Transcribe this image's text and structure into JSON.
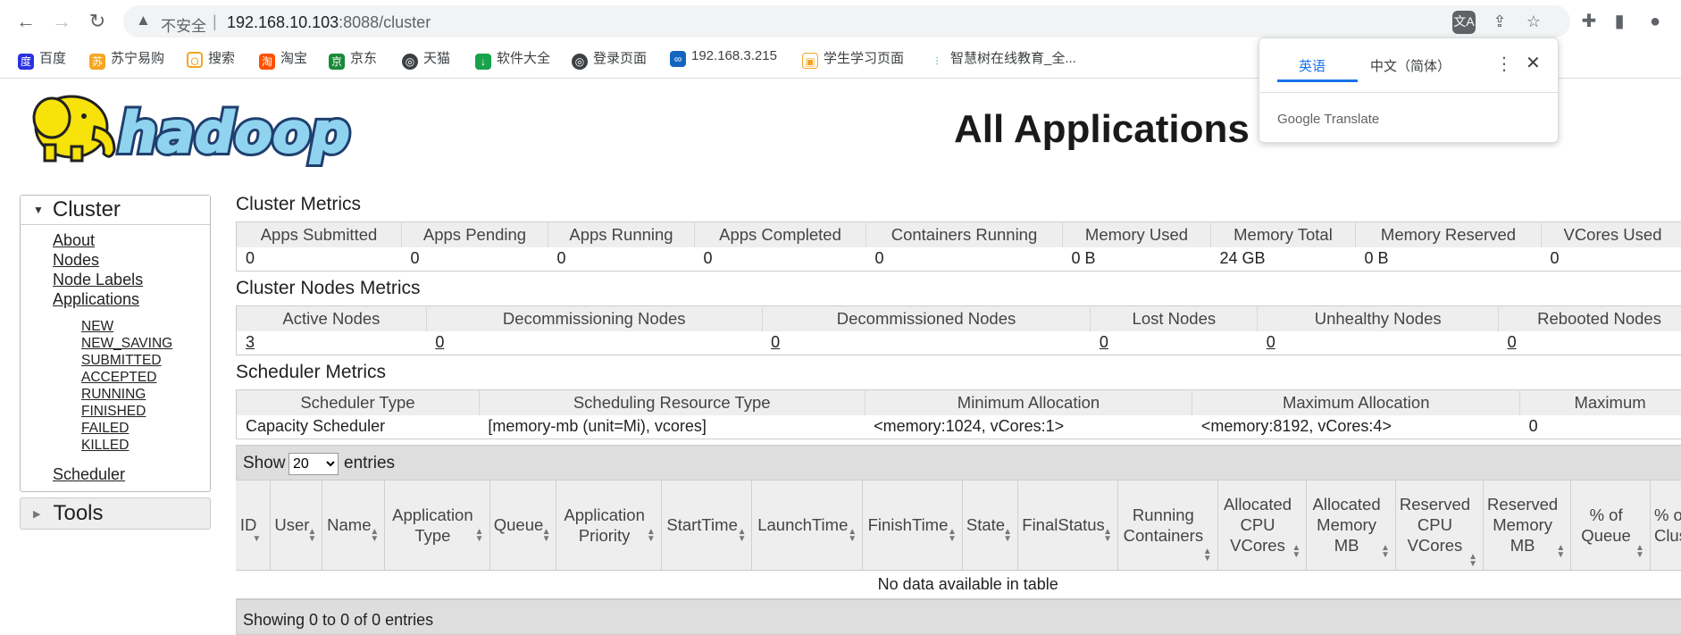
{
  "browser": {
    "insecure_label": "不安全",
    "url_host": "192.168.10.103",
    "url_rest": ":8088/cluster",
    "bookmarks": [
      "百度",
      "苏宁易购",
      "搜索",
      "淘宝",
      "京东",
      "天猫",
      "软件大全",
      "登录页面",
      "192.168.3.215",
      "学生学习页面",
      "智慧树在线教育_全..."
    ]
  },
  "translate_popup": {
    "lang_source": "英语",
    "lang_target": "中文（简体）",
    "brand": "Google Translate"
  },
  "page": {
    "title": "All Applications"
  },
  "sidebar": {
    "cluster_label": "Cluster",
    "links": [
      "About",
      "Nodes",
      "Node Labels",
      "Applications"
    ],
    "app_states": [
      "NEW",
      "NEW_SAVING",
      "SUBMITTED",
      "ACCEPTED",
      "RUNNING",
      "FINISHED",
      "FAILED",
      "KILLED"
    ],
    "scheduler_label": "Scheduler",
    "tools_label": "Tools"
  },
  "cluster_metrics": {
    "title": "Cluster Metrics",
    "headers": [
      "Apps Submitted",
      "Apps Pending",
      "Apps Running",
      "Apps Completed",
      "Containers Running",
      "Memory Used",
      "Memory Total",
      "Memory Reserved",
      "VCores Used"
    ],
    "values": [
      "0",
      "0",
      "0",
      "0",
      "0",
      "0 B",
      "24 GB",
      "0 B",
      "0"
    ]
  },
  "node_metrics": {
    "title": "Cluster Nodes Metrics",
    "headers": [
      "Active Nodes",
      "Decommissioning Nodes",
      "Decommissioned Nodes",
      "Lost Nodes",
      "Unhealthy Nodes",
      "Rebooted Nodes"
    ],
    "values": [
      "3",
      "0",
      "0",
      "0",
      "0",
      "0"
    ]
  },
  "scheduler_metrics": {
    "title": "Scheduler Metrics",
    "headers": [
      "Scheduler Type",
      "Scheduling Resource Type",
      "Minimum Allocation",
      "Maximum Allocation",
      "Maximum"
    ],
    "values": [
      "Capacity Scheduler",
      "[memory-mb (unit=Mi), vcores]",
      "<memory:1024, vCores:1>",
      "<memory:8192, vCores:4>",
      "0"
    ]
  },
  "apps_table": {
    "show_label": "Show",
    "page_size": "20",
    "entries_label": "entries",
    "columns": [
      "ID",
      "User",
      "Name",
      "Application Type",
      "Queue",
      "Application Priority",
      "StartTime",
      "LaunchTime",
      "FinishTime",
      "State",
      "FinalStatus",
      "Running Containers",
      "Allocated CPU VCores",
      "Allocated Memory MB",
      "Reserved CPU VCores",
      "Reserved Memory MB",
      "% of Queue",
      "% of Clus"
    ],
    "empty_message": "No data available in table",
    "footer": "Showing 0 to 0 of 0 entries"
  }
}
